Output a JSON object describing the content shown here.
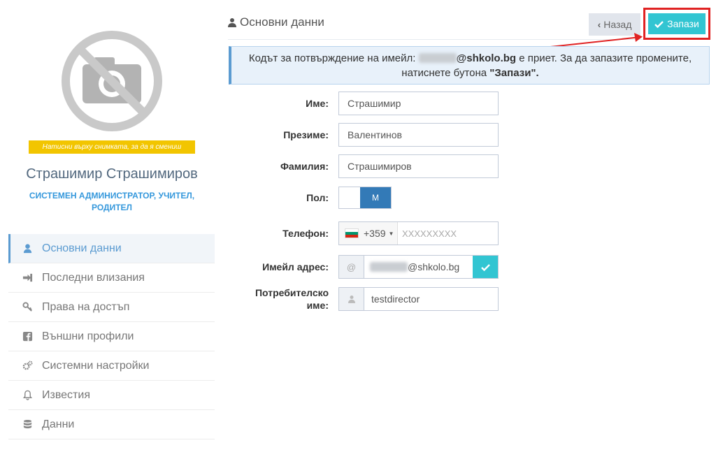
{
  "sidebar": {
    "photo_hint": "Натисни върху снимката, за да я смениш",
    "user_name": "Страшимир Страшимиров",
    "user_role": "СИСТЕМЕН АДМИНИСТРАТОР, УЧИТЕЛ, РОДИТЕЛ",
    "items": [
      {
        "label": "Основни данни",
        "icon": "user-icon",
        "active": true
      },
      {
        "label": "Последни влизания",
        "icon": "sign-in-icon"
      },
      {
        "label": "Права на достъп",
        "icon": "key-icon"
      },
      {
        "label": "Външни профили",
        "icon": "facebook-icon"
      },
      {
        "label": "Системни настройки",
        "icon": "cogs-icon"
      },
      {
        "label": "Известия",
        "icon": "bell-icon"
      },
      {
        "label": "Данни",
        "icon": "database-icon"
      }
    ]
  },
  "header": {
    "title": "Основни данни",
    "back_label": "Назад",
    "save_label": "Запази"
  },
  "alert": {
    "prefix": "Кодът за потвърждение на имейл:",
    "email_domain": "@shkolo.bg",
    "middle": "е приет. За да запазите промените, натиснете бутона",
    "button_ref": "\"Запази\"."
  },
  "form": {
    "first_name_label": "Име:",
    "first_name": "Страшимир",
    "middle_name_label": "Презиме:",
    "middle_name": "Валентинов",
    "last_name_label": "Фамилия:",
    "last_name": "Страшимиров",
    "gender_label": "Пол:",
    "gender_value": "М",
    "phone_label": "Телефон:",
    "phone_code": "+359",
    "phone_placeholder": "XXXXXXXXX",
    "email_label": "Имейл адрес:",
    "email_addon": "@",
    "email_domain": "@shkolo.bg",
    "username_label": "Потребителско име:",
    "username": "testdirector"
  },
  "colors": {
    "accent_blue": "#5b9bd1",
    "save_cyan": "#32c5d2",
    "highlight_red": "#e02222",
    "hint_yellow": "#f2c500"
  }
}
